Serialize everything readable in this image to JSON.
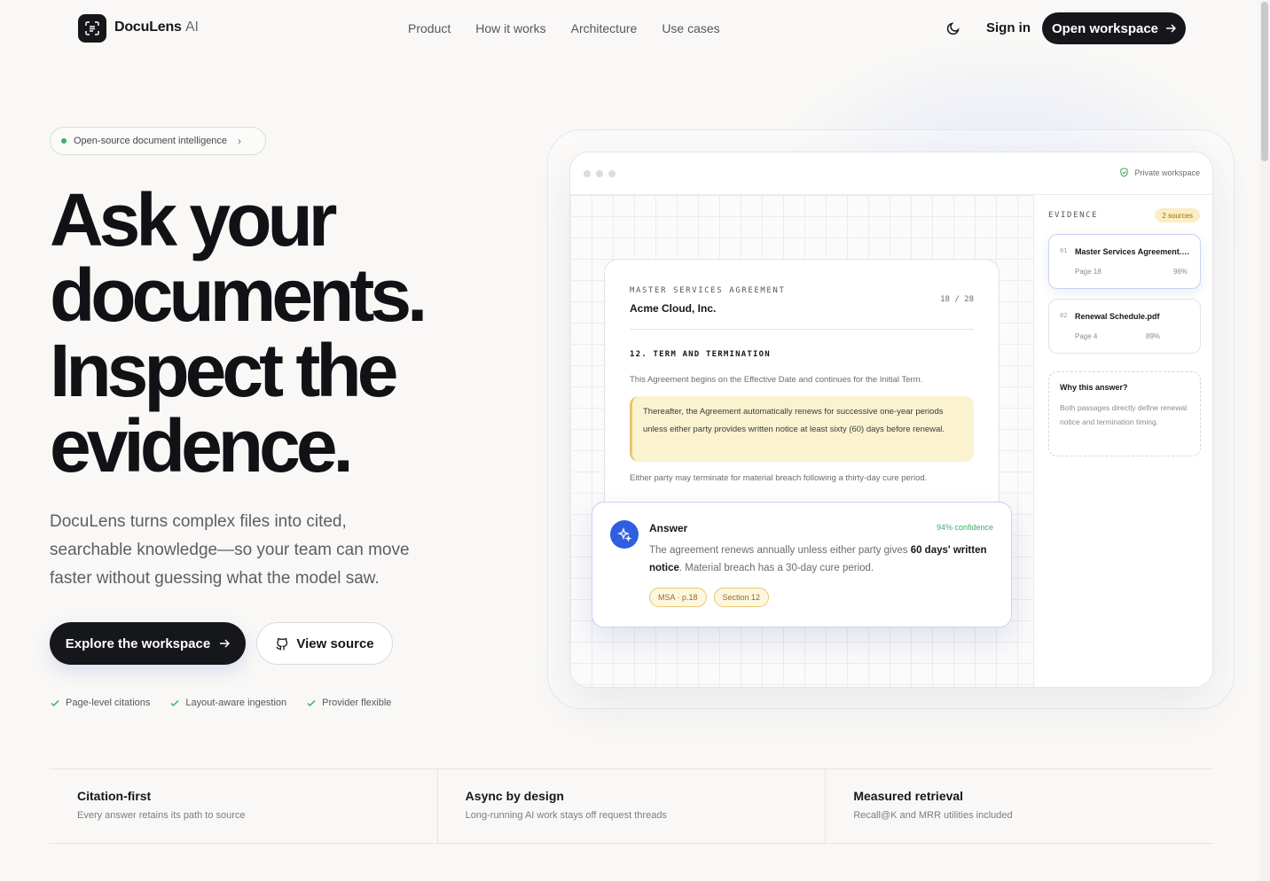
{
  "nav": {
    "brand": "DocuLens",
    "brand_suffix": "AI",
    "links": [
      "Product",
      "How it works",
      "Architecture",
      "Use cases"
    ],
    "signin": "Sign in",
    "cta": "Open workspace"
  },
  "hero": {
    "pill": "Open-source document intelligence",
    "headline": [
      "Ask your",
      "documents.",
      "Inspect the",
      "evidence."
    ],
    "subtitle": "DocuLens turns complex files into cited, searchable knowledge—so your team can move faster without guessing what the model saw.",
    "primary_cta": "Explore the workspace",
    "secondary_cta": "View source",
    "checks": [
      "Page-level citations",
      "Layout-aware ingestion",
      "Provider flexible"
    ]
  },
  "mockup": {
    "private_label": "Private workspace",
    "doc": {
      "eyebrow": "MASTER SERVICES AGREEMENT",
      "company": "Acme Cloud, Inc.",
      "page": "18 / 28",
      "section": "12. TERM AND TERMINATION",
      "para1": "This Agreement begins on the Effective Date and continues for the Initial Term.",
      "highlight": "Thereafter, the Agreement automatically renews for successive one-year periods unless either party provides written notice at least sixty (60) days before renewal.",
      "para2": "Either party may terminate for material breach following a thirty-day cure period."
    },
    "answer": {
      "title": "Answer",
      "confidence": "94% confidence",
      "text_a": "The agreement renews annually unless either party gives ",
      "text_b": "60 days' written notice",
      "text_c": ". Material breach has a 30-day cure period.",
      "chips": [
        "MSA · p.18",
        "Section 12"
      ]
    },
    "evidence": {
      "label": "EVIDENCE",
      "badge": "2 sources",
      "sources": [
        {
          "num": "01",
          "name": "Master Services Agreement.pdf",
          "page": "Page 18",
          "score": "96%"
        },
        {
          "num": "02",
          "name": "Renewal Schedule.pdf",
          "page": "Page 4",
          "score": "89%"
        }
      ],
      "why_title": "Why this answer?",
      "why_text": "Both passages directly define renewal notice and termination timing."
    }
  },
  "features": [
    {
      "title": "Citation-first",
      "desc": "Every answer retains its path to source"
    },
    {
      "title": "Async by design",
      "desc": "Long-running AI work stays off request threads"
    },
    {
      "title": "Measured retrieval",
      "desc": "Recall@K and MRR utilities included"
    }
  ],
  "colors": {
    "accent": "#2f5fe0",
    "dark": "#16171b",
    "highlight": "#fbf3cf",
    "success": "#3fae6a"
  }
}
